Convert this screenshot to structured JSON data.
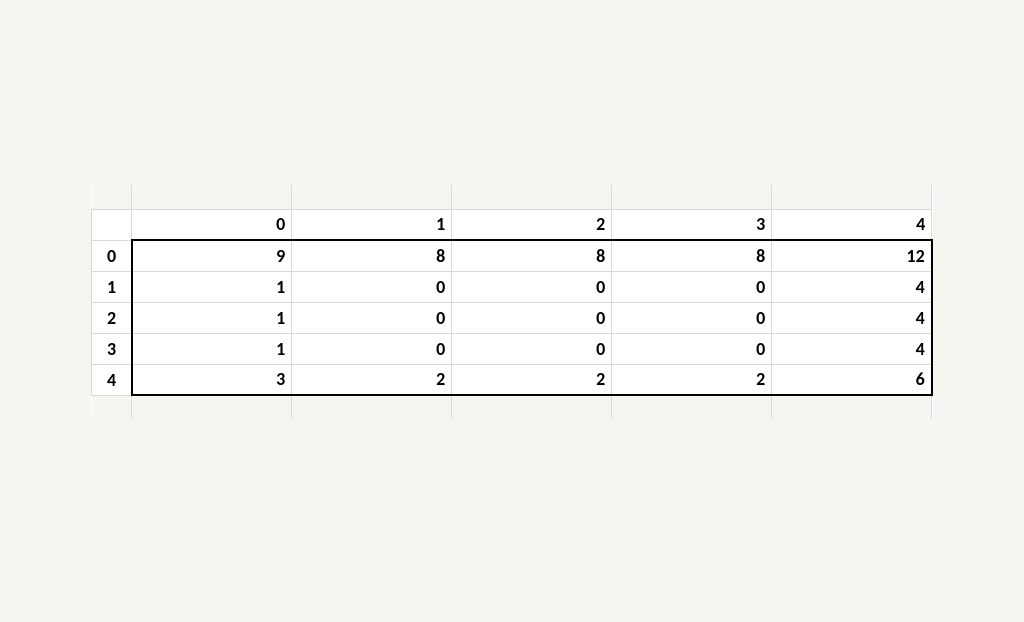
{
  "chart_data": {
    "type": "table",
    "columns": [
      "0",
      "1",
      "2",
      "3",
      "4"
    ],
    "index": [
      "0",
      "1",
      "2",
      "3",
      "4"
    ],
    "rows": [
      [
        "9",
        "8",
        "8",
        "8",
        "12"
      ],
      [
        "1",
        "0",
        "0",
        "0",
        "4"
      ],
      [
        "1",
        "0",
        "0",
        "0",
        "4"
      ],
      [
        "1",
        "0",
        "0",
        "0",
        "4"
      ],
      [
        "3",
        "2",
        "2",
        "2",
        "6"
      ]
    ]
  }
}
